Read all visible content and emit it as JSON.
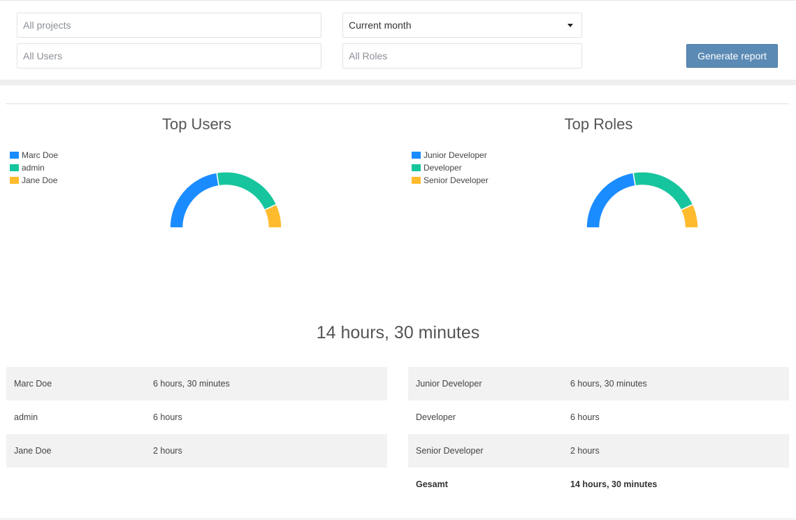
{
  "filters": {
    "projects_placeholder": "All projects",
    "users_placeholder": "All Users",
    "period_value": "Current month",
    "roles_placeholder": "All Roles",
    "generate_label": "Generate report"
  },
  "colors": {
    "blue": "#1a8cff",
    "green": "#16c59d",
    "yellow": "#ffbb2e"
  },
  "chart_data": [
    {
      "type": "pie",
      "title": "Top Users",
      "variant": "half-donut",
      "legend_position": "top-left",
      "labels": [
        "Marc Doe",
        "admin",
        "Jane Doe"
      ],
      "values": [
        6.5,
        6,
        2
      ],
      "colors": [
        "#1a8cff",
        "#16c59d",
        "#ffbb2e"
      ]
    },
    {
      "type": "pie",
      "title": "Top Roles",
      "variant": "half-donut",
      "legend_position": "top-left",
      "labels": [
        "Junior Developer",
        "Developer",
        "Senior Developer"
      ],
      "values": [
        6.5,
        6,
        2
      ],
      "colors": [
        "#1a8cff",
        "#16c59d",
        "#ffbb2e"
      ]
    }
  ],
  "total_label": "14 hours, 30 minutes",
  "users_table": [
    {
      "name": "Marc Doe",
      "time": "6 hours, 30 minutes"
    },
    {
      "name": "admin",
      "time": "6 hours"
    },
    {
      "name": "Jane Doe",
      "time": "2 hours"
    }
  ],
  "roles_table": [
    {
      "name": "Junior Developer",
      "time": "6 hours, 30 minutes"
    },
    {
      "name": "Developer",
      "time": "6 hours"
    },
    {
      "name": "Senior Developer",
      "time": "2 hours"
    }
  ],
  "roles_total": {
    "name": "Gesamt",
    "time": "14 hours, 30 minutes"
  }
}
